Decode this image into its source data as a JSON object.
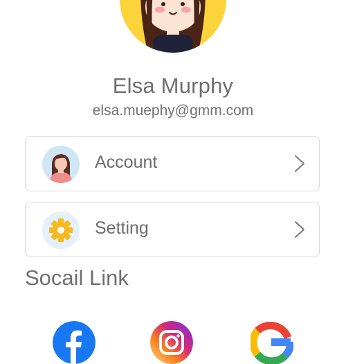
{
  "profile": {
    "name": "Elsa Murphy",
    "email": "elsa.muephy@gmm.com"
  },
  "menu": {
    "items": [
      {
        "label": "Account",
        "icon": "user-avatar-icon"
      },
      {
        "label": "Setting",
        "icon": "gear-icon"
      }
    ]
  },
  "social": {
    "title": "Socail Link",
    "links": [
      {
        "icon": "facebook-icon"
      },
      {
        "icon": "instagram-icon"
      },
      {
        "icon": "google-icon"
      }
    ]
  },
  "colors": {
    "avatar_bg": "#fcd33a",
    "card_border": "#d8d8d8",
    "text": "#6f6f6f",
    "facebook": "#1877f2",
    "gear": "#f6b91d"
  }
}
